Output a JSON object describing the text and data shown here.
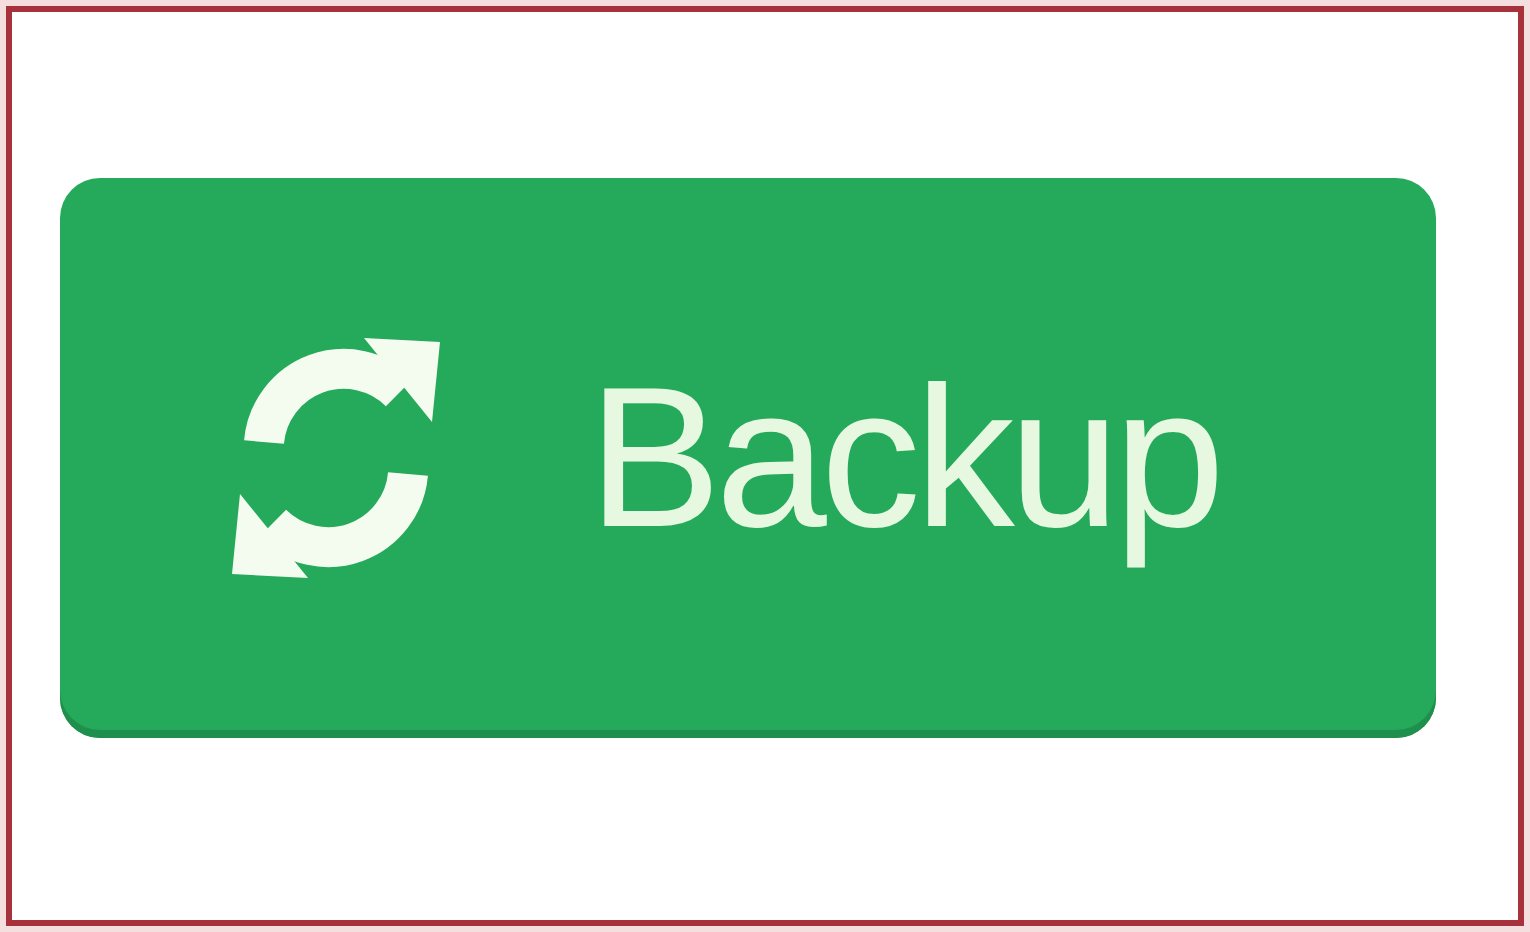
{
  "button": {
    "label": "Backup"
  }
}
